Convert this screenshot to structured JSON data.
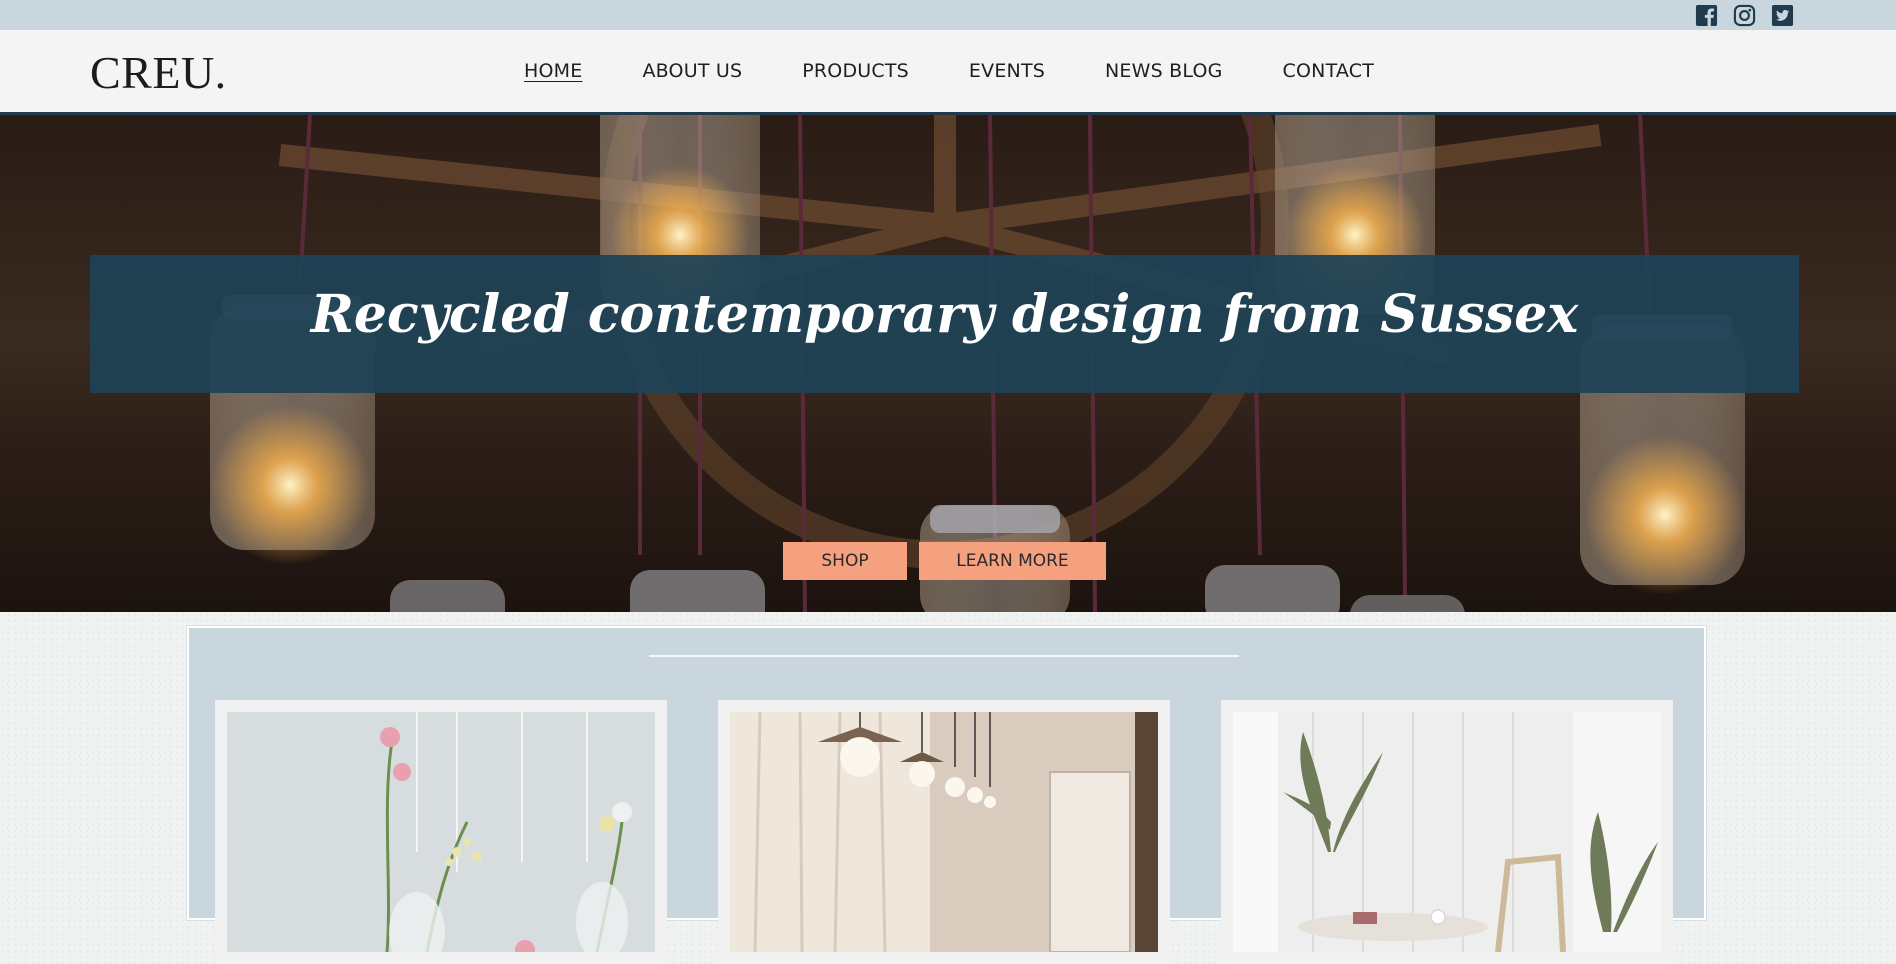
{
  "brand": {
    "logo": "CREU."
  },
  "social": {
    "icons": [
      "facebook-icon",
      "instagram-icon",
      "twitter-icon"
    ],
    "color": "#1f3b4d"
  },
  "nav": {
    "items": [
      {
        "label": "HOME",
        "active": true
      },
      {
        "label": "ABOUT US",
        "active": false
      },
      {
        "label": "PRODUCTS",
        "active": false
      },
      {
        "label": "EVENTS",
        "active": false
      },
      {
        "label": "NEWS BLOG",
        "active": false
      },
      {
        "label": "CONTACT",
        "active": false
      }
    ]
  },
  "hero": {
    "headline": "Recycled contemporary design from Sussex",
    "buttons": {
      "shop": "SHOP",
      "learn_more": "LEARN MORE"
    }
  },
  "colors": {
    "topbar": "#c9d6dd",
    "banner": "#1e4356",
    "button": "#f5a07e",
    "header_border": "#1f3b4d"
  },
  "products": {
    "cards": [
      {
        "image": "flowers-in-hanging-bulb-vases"
      },
      {
        "image": "room-with-pendant-lights"
      },
      {
        "image": "white-room-with-plants"
      }
    ]
  }
}
